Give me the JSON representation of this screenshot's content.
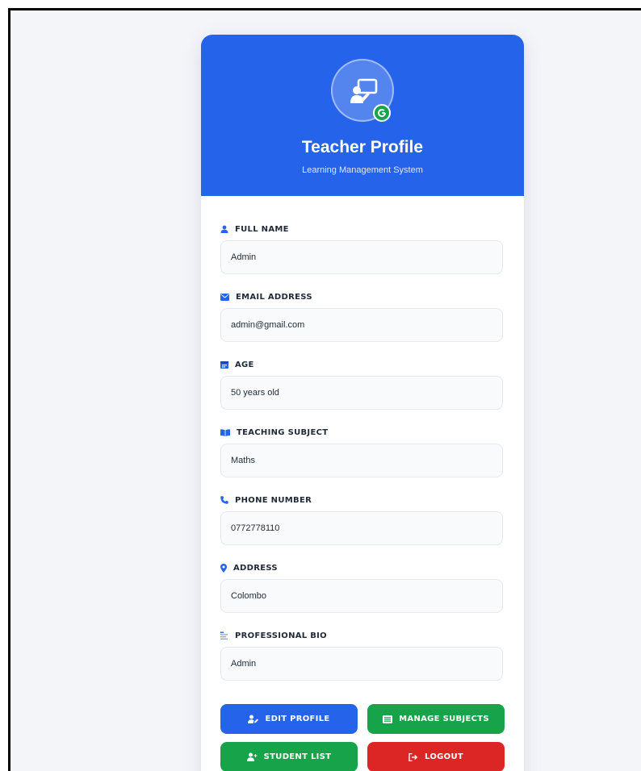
{
  "header": {
    "title": "Teacher Profile",
    "subtitle": "Learning Management System",
    "avatar_icon": "teacher-board-icon",
    "badge_icon": "google-g-icon"
  },
  "fields": [
    {
      "label": "FULL NAME",
      "value": "Admin",
      "icon": "user-icon"
    },
    {
      "label": "EMAIL ADDRESS",
      "value": "admin@gmail.com",
      "icon": "envelope-icon"
    },
    {
      "label": "AGE",
      "value": "50 years old",
      "icon": "calendar-icon"
    },
    {
      "label": "TEACHING SUBJECT",
      "value": "Maths",
      "icon": "book-open-icon"
    },
    {
      "label": "PHONE NUMBER",
      "value": "0772778110",
      "icon": "phone-icon"
    },
    {
      "label": "ADDRESS",
      "value": "Colombo",
      "icon": "map-pin-icon"
    },
    {
      "label": "PROFESSIONAL BIO",
      "value": "Admin",
      "icon": "text-align-icon"
    }
  ],
  "buttons": {
    "edit_profile": "EDIT PROFILE",
    "manage_subjects": "MANAGE SUBJECTS",
    "student_list": "STUDENT LIST",
    "logout": "LOGOUT"
  },
  "colors": {
    "primary": "#2563eb",
    "success": "#16a34a",
    "danger": "#dc2626",
    "label_icon": "#2563eb"
  }
}
